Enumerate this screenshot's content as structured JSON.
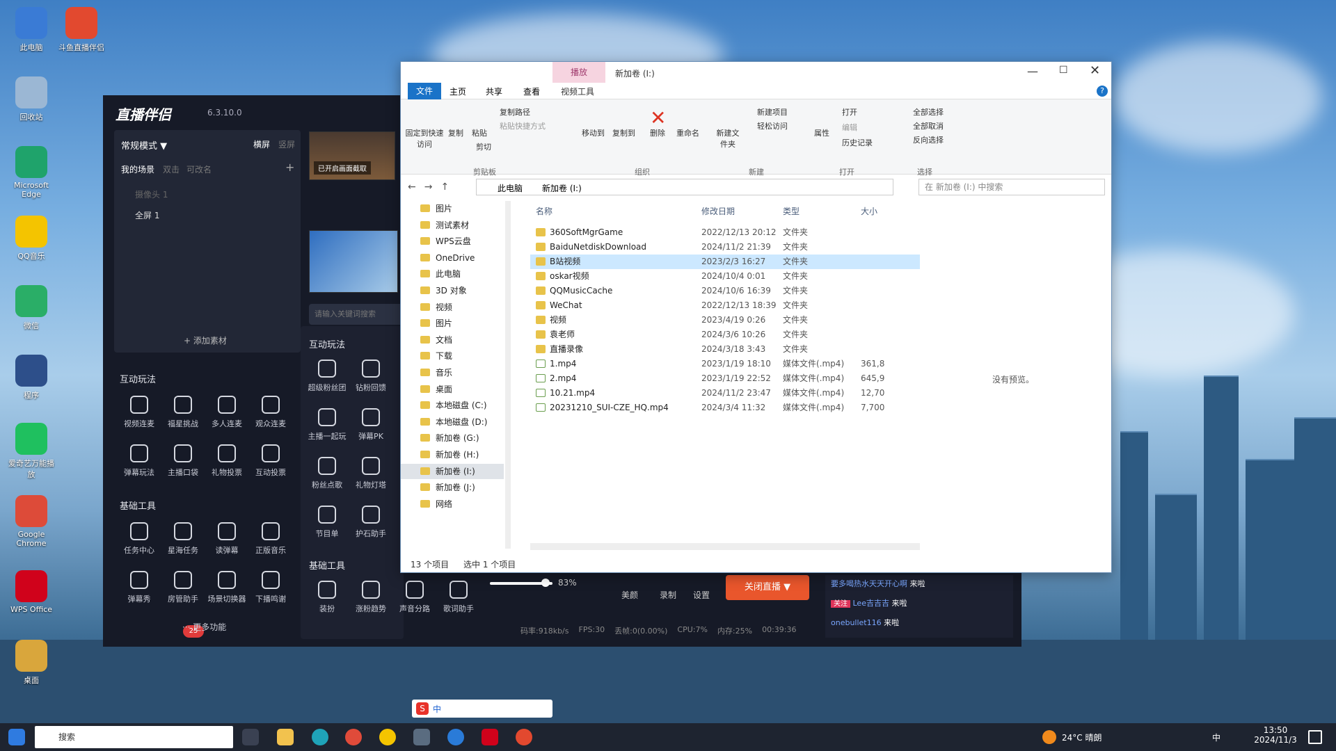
{
  "desktop": {
    "icons": [
      {
        "label": "此电脑",
        "color": "#3a7bd5"
      },
      {
        "label": "斗鱼直播伴侣",
        "color": "#e2492f"
      },
      {
        "label": "回收站",
        "color": "#9bb7d4"
      },
      {
        "label": "Microsoft Edge",
        "color": "#1fa36b"
      },
      {
        "label": "QQ音乐",
        "color": "#f4c400"
      },
      {
        "label": "微信",
        "color": "#2aae67"
      },
      {
        "label": "程序",
        "color": "#2d4f8a"
      },
      {
        "label": "爱奇艺万能播放",
        "color": "#1fc05f"
      },
      {
        "label": "Google Chrome",
        "color": "#dd4b39"
      },
      {
        "label": "WPS Office",
        "color": "#d0021b"
      },
      {
        "label": "桌面",
        "color": "#d9a63c"
      }
    ]
  },
  "stream_app": {
    "title": "直播伴侣",
    "version": "6.3.10.0",
    "mode": "常规模式",
    "orientation": [
      "横屏",
      "竖屏"
    ],
    "scene_label": "我的场景",
    "scene_opts": [
      "双击",
      "可改名"
    ],
    "sources": [
      "摄像头 1",
      "全屏 1"
    ],
    "add_material": "添加素材",
    "preview_overlay": "已开启画面截取",
    "search_placeholder": "请输入关键词搜索",
    "interactive_title": "互动玩法",
    "interactive_items": [
      "视频连麦",
      "福星挑战",
      "多人连麦",
      "观众连麦",
      "弹幕玩法",
      "主播口袋",
      "礼物投票",
      "互动投票"
    ],
    "basic_title": "基础工具",
    "basic_items": [
      "任务中心",
      "星海任务",
      "读弹幕",
      "正版音乐",
      "弹幕秀",
      "房管助手",
      "场景切换器",
      "下播鸣谢"
    ],
    "more": "更多功能",
    "badge": "25",
    "right_interactive_title": "互动玩法",
    "right_interactive_items": [
      "超级粉丝团",
      "钻粉回馈",
      "主播一起玩",
      "弹幕PK",
      "粉丝点歌",
      "礼物灯塔",
      "节目单",
      "护石助手"
    ],
    "right_basic_title": "基础工具",
    "right_basic_items": [
      "装扮",
      "涨粉趋势",
      "声音分路",
      "歌词助手"
    ],
    "volume": "83%",
    "controls": [
      "美颜",
      "录制",
      "设置"
    ],
    "live_button": "关闭直播",
    "status": {
      "bitrate": "码率:918kb/s",
      "fps": "FPS:30",
      "drop": "丢帧:0(0.00%)",
      "cpu": "CPU:7%",
      "mem": "内存:25%",
      "time": "00:39:36"
    },
    "chat": [
      {
        "user": "要多喝热水天天开心啊",
        "msg": "来啦"
      },
      {
        "user": "Lee吉吉吉",
        "msg": "来啦",
        "tag": "关注"
      },
      {
        "user": "onebullet116",
        "msg": "来啦"
      }
    ]
  },
  "explorer": {
    "title": "新加卷 (I:)",
    "context_tab": "播放",
    "context_sub": "视频工具",
    "tabs": [
      "文件",
      "主页",
      "共享",
      "查看"
    ],
    "ribbon": {
      "clipboard": {
        "group": "剪贴板",
        "pin": "固定到快速访问",
        "copy": "复制",
        "paste": "粘贴",
        "copy_path": "复制路径",
        "paste_shortcut": "粘贴快捷方式",
        "cut": "剪切"
      },
      "organize": {
        "group": "组织",
        "move": "移动到",
        "copy_to": "复制到",
        "delete": "删除",
        "rename": "重命名"
      },
      "new": {
        "group": "新建",
        "new_folder": "新建文件夹",
        "new_item": "新建项目",
        "easy_access": "轻松访问"
      },
      "open": {
        "group": "打开",
        "props": "属性",
        "open": "打开",
        "edit": "编辑",
        "history": "历史记录"
      },
      "select": {
        "group": "选择",
        "all": "全部选择",
        "none": "全部取消",
        "invert": "反向选择"
      }
    },
    "breadcrumb": [
      "此电脑",
      "新加卷 (I:)"
    ],
    "search_placeholder": "在 新加卷 (I:) 中搜索",
    "nav": [
      "图片",
      "测试素材",
      "WPS云盘",
      "OneDrive",
      "此电脑",
      "3D 对象",
      "视频",
      "图片",
      "文档",
      "下载",
      "音乐",
      "桌面",
      "本地磁盘 (C:)",
      "本地磁盘 (D:)",
      "新加卷 (G:)",
      "新加卷 (H:)",
      "新加卷 (I:)",
      "新加卷 (J:)",
      "网络"
    ],
    "columns": [
      "名称",
      "修改日期",
      "类型",
      "大小"
    ],
    "files": [
      {
        "name": "360SoftMgrGame",
        "date": "2022/12/13 20:12",
        "type": "文件夹",
        "size": ""
      },
      {
        "name": "BaiduNetdiskDownload",
        "date": "2024/11/2 21:39",
        "type": "文件夹",
        "size": ""
      },
      {
        "name": "B站视频",
        "date": "2023/2/3 16:27",
        "type": "文件夹",
        "size": ""
      },
      {
        "name": "oskar视频",
        "date": "2024/10/4 0:01",
        "type": "文件夹",
        "size": ""
      },
      {
        "name": "QQMusicCache",
        "date": "2024/10/6 16:39",
        "type": "文件夹",
        "size": ""
      },
      {
        "name": "WeChat",
        "date": "2022/12/13 18:39",
        "type": "文件夹",
        "size": ""
      },
      {
        "name": "视频",
        "date": "2023/4/19 0:26",
        "type": "文件夹",
        "size": ""
      },
      {
        "name": "袁老师",
        "date": "2024/3/6 10:26",
        "type": "文件夹",
        "size": ""
      },
      {
        "name": "直播录像",
        "date": "2024/3/18 3:43",
        "type": "文件夹",
        "size": ""
      },
      {
        "name": "1.mp4",
        "date": "2023/1/19 18:10",
        "type": "媒体文件(.mp4)",
        "size": "361,8"
      },
      {
        "name": "2.mp4",
        "date": "2023/1/19 22:52",
        "type": "媒体文件(.mp4)",
        "size": "645,9"
      },
      {
        "name": "10.21.mp4",
        "date": "2024/11/2 23:47",
        "type": "媒体文件(.mp4)",
        "size": "12,70"
      },
      {
        "name": "20231210_SUI-CZE_HQ.mp4",
        "date": "2024/3/4 11:32",
        "type": "媒体文件(.mp4)",
        "size": "7,700"
      }
    ],
    "selected_index": 2,
    "preview": "没有预览。",
    "status_count": "13 个项目",
    "status_sel": "选中 1 个项目"
  },
  "taskbar": {
    "search": "搜索",
    "weather": "24°C 晴朗",
    "ime": "中",
    "time": "13:50",
    "date": "2024/11/3"
  },
  "ime_bar": {
    "mode": "中"
  }
}
